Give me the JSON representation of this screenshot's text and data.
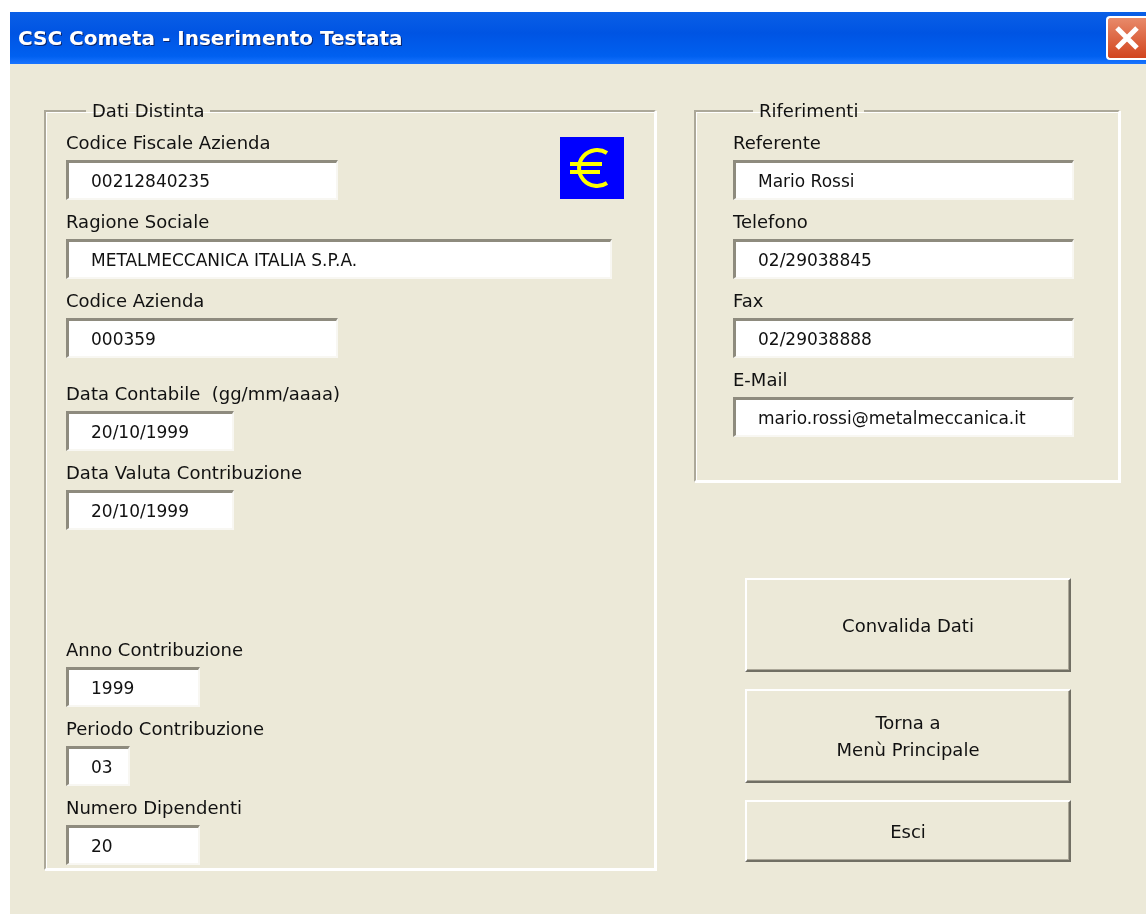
{
  "window": {
    "title": "CSC Cometa - Inserimento Testata"
  },
  "dati_distinta": {
    "title": "Dati Distinta",
    "fields": [
      {
        "label": "Codice Fiscale Azienda",
        "value": "00212840235"
      },
      {
        "label": "Ragione Sociale",
        "value": "METALMECCANICA ITALIA S.P.A."
      },
      {
        "label": "Codice Azienda",
        "value": "000359"
      },
      {
        "label": "Data Contabile  (gg/mm/aaaa)",
        "value": "20/10/1999"
      },
      {
        "label": "Data Valuta Contribuzione",
        "value": "20/10/1999"
      },
      {
        "label": "Anno Contribuzione",
        "value": "1999"
      },
      {
        "label": "Periodo Contribuzione",
        "value": "03"
      },
      {
        "label": "Numero Dipendenti",
        "value": "20"
      }
    ]
  },
  "riferimenti": {
    "title": "Riferimenti",
    "fields": [
      {
        "label": "Referente",
        "value": "Mario Rossi"
      },
      {
        "label": "Telefono",
        "value": "02/29038845"
      },
      {
        "label": "Fax",
        "value": "02/29038888"
      },
      {
        "label": "E-Mail",
        "value": "mario.rossi@metalmeccanica.it"
      }
    ]
  },
  "buttons": [
    "Convalida Dati",
    "Torna a\nMenù Principale",
    "Esci"
  ]
}
